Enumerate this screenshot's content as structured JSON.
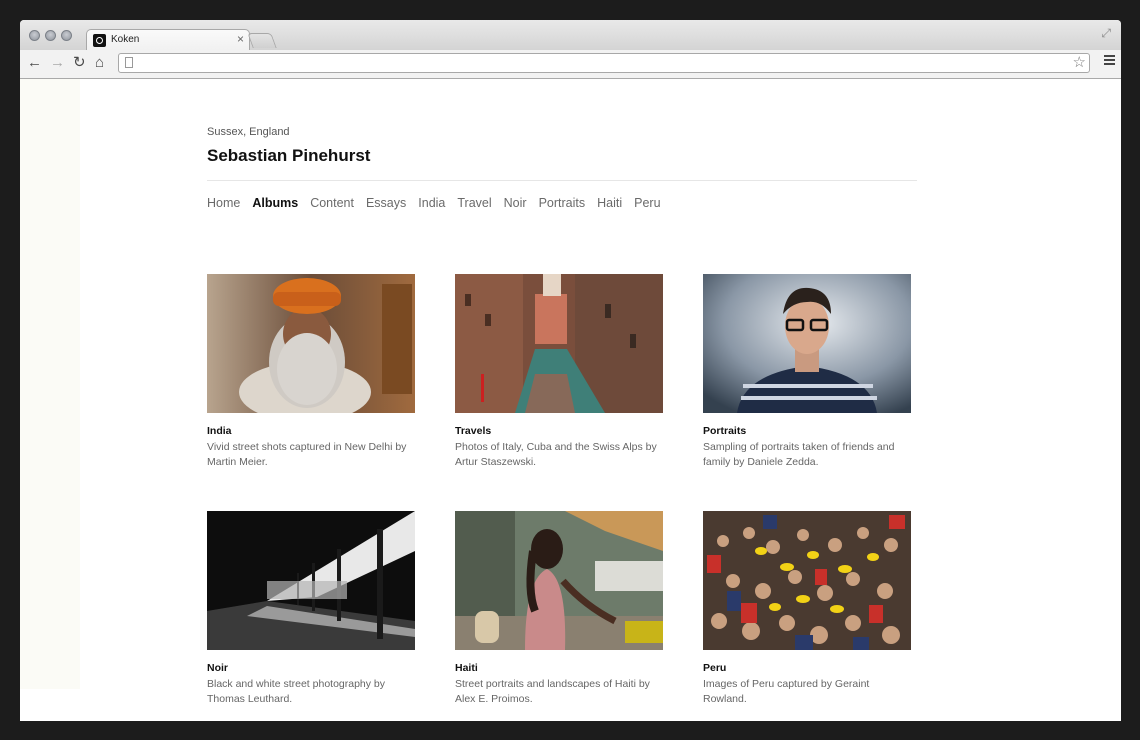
{
  "browser": {
    "tab_title": "Koken",
    "tab_close": "×",
    "address": ""
  },
  "site": {
    "location": "Sussex, England",
    "title": "Sebastian Pinehurst"
  },
  "nav": [
    {
      "label": "Home",
      "active": false
    },
    {
      "label": "Albums",
      "active": true
    },
    {
      "label": "Content",
      "active": false
    },
    {
      "label": "Essays",
      "active": false
    },
    {
      "label": "India",
      "active": false
    },
    {
      "label": "Travel",
      "active": false
    },
    {
      "label": "Noir",
      "active": false
    },
    {
      "label": "Portraits",
      "active": false
    },
    {
      "label": "Haiti",
      "active": false
    },
    {
      "label": "Peru",
      "active": false
    }
  ],
  "albums": [
    {
      "title": "India",
      "description": "Vivid street shots captured in New Delhi by Martin Meier."
    },
    {
      "title": "Travels",
      "description": "Photos of Italy, Cuba and the Swiss Alps by Artur Staszewski."
    },
    {
      "title": "Portraits",
      "description": "Sampling of portraits taken of friends and family by Daniele Zedda."
    },
    {
      "title": "Noir",
      "description": "Black and white street photography by Thomas Leuthard."
    },
    {
      "title": "Haiti",
      "description": "Street portraits and landscapes of Haiti by Alex E. Proimos."
    },
    {
      "title": "Peru",
      "description": "Images of Peru captured by Geraint Rowland."
    }
  ],
  "icons": {
    "back": "back-arrow-icon",
    "forward": "forward-arrow-icon",
    "reload": "reload-icon",
    "home": "home-icon",
    "bookmark": "star-icon",
    "menu": "menu-icon"
  },
  "colors": {
    "background": "#1c1c1c",
    "text_active": "#111111",
    "text_muted": "#6a6a6a"
  }
}
